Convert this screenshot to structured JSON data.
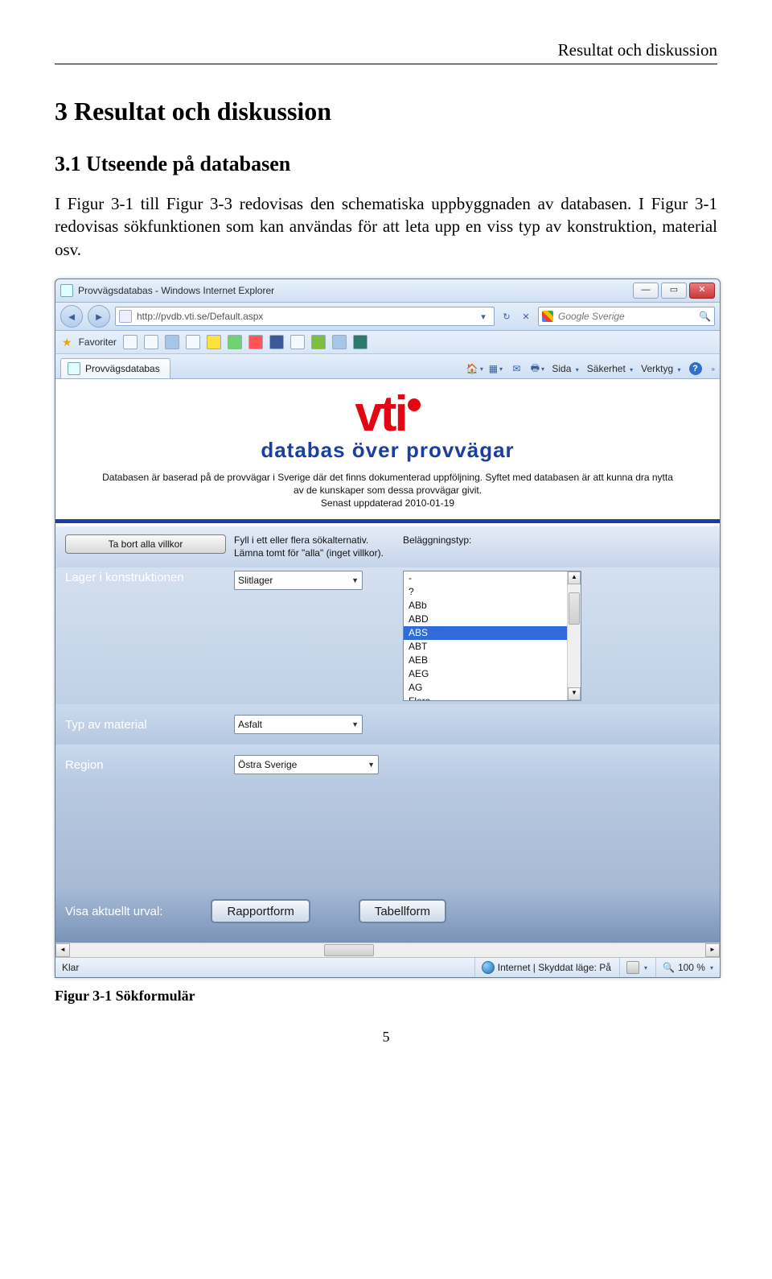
{
  "doc": {
    "running_header": "Resultat och diskussion",
    "h1": "3  Resultat och diskussion",
    "h2": "3.1  Utseende på databasen",
    "paragraph": "I Figur 3-1 till Figur 3-3 redovisas den schematiska uppbyggnaden av databasen. I Figur 3-1 redovisas sökfunktionen som kan användas för att leta upp en viss typ av konstruktion, material osv.",
    "figure_caption": "Figur 3-1 Sökformulär",
    "page_number": "5"
  },
  "window": {
    "title": "Provvägsdatabas - Windows Internet Explorer",
    "url": "http://pvdb.vti.se/Default.aspx",
    "search_placeholder": "Google Sverige",
    "favorites_label": "Favoriter",
    "tab_label": "Provvägsdatabas",
    "toolbar": {
      "sida": "Sida",
      "sakerhet": "Säkerhet",
      "verktyg": "Verktyg"
    },
    "statusbar": {
      "left": "Klar",
      "zone": "Internet | Skyddat läge: På",
      "zoom": "100 %"
    }
  },
  "page": {
    "logo_text": "vti",
    "subtitle": "databas över provvägar",
    "description_line1": "Databasen är baserad på de provvägar i Sverige där det finns dokumenterad uppföljning. Syftet med databasen är att kunna dra nytta",
    "description_line2": "av de kunskaper som dessa provvägar givit.",
    "description_line3": "Senast uppdaterad 2010-01-19",
    "remove_button": "Ta bort alla villkor",
    "hint_line1": "Fyll i ett eller flera sökalternativ.",
    "hint_line2": "Lämna tomt för \"alla\" (inget villkor).",
    "belaggning_label": "Beläggningstyp:",
    "labels": {
      "lager": "Lager i konstruktionen",
      "typ": "Typ av material",
      "region": "Region"
    },
    "combos": {
      "lager": "Slitlager",
      "typ": "Asfalt",
      "region": "Östra Sverige"
    },
    "listbox_options": [
      "-",
      "?",
      "ABb",
      "ABD",
      "ABS",
      "ABT",
      "AEB",
      "AEG",
      "AG",
      "Flera"
    ],
    "listbox_selected": "ABS",
    "visa_label": "Visa aktuellt urval:",
    "rapport_btn": "Rapportform",
    "tabell_btn": "Tabellform"
  }
}
